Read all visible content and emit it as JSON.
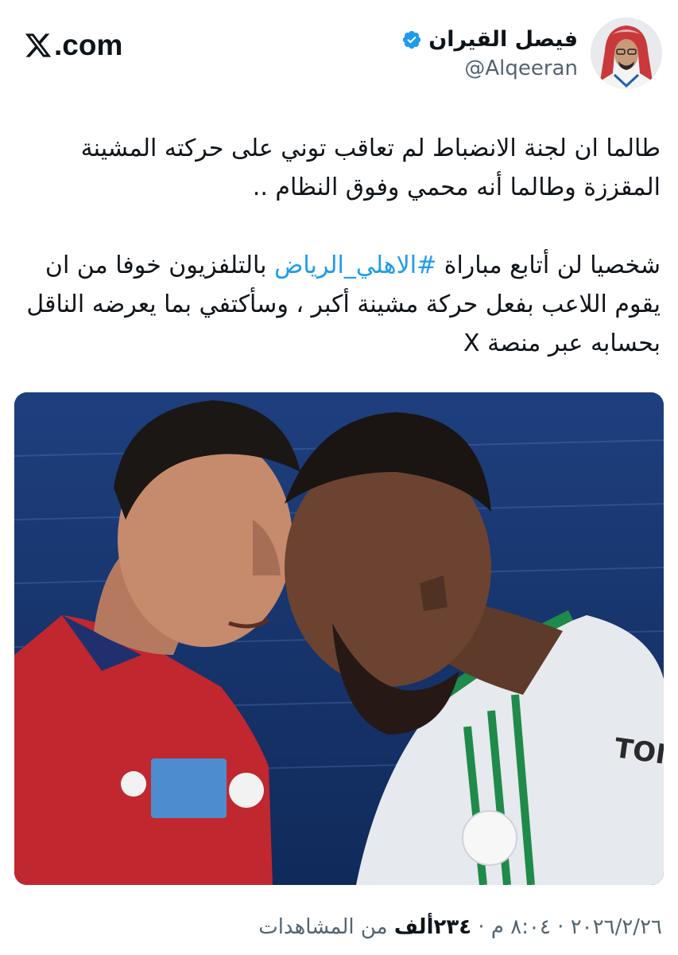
{
  "brand": {
    "label": ".com",
    "icon": "x-logo-icon"
  },
  "author": {
    "display_name": "فيصل القيران",
    "handle": "@Alqeeran",
    "verified": true,
    "verified_color": "#1d9bf0"
  },
  "tweet": {
    "paragraph_1": "طالما ان لجنة الانضباط لم تعاقب توني على حركته المشينة المقززة وطالما أنه محمي وفوق النظام ..",
    "paragraph_2_before": "شخصيا لن أتابع مباراة ",
    "hashtag": "#الاهلي_الرياض",
    "paragraph_2_after": " بالتلفزيون خوفا من ان يقوم اللاعب بفعل حركة مشينة أكبر ، وسأكتفي بما يعرضه الناقل بحسابه عبر منصة X",
    "hashtag_color": "#1d9bf0"
  },
  "media": {
    "type": "photo",
    "jersey_lettering": "TON"
  },
  "meta": {
    "date": "٢٠٢٦/٢/٢٦",
    "separator": " · ",
    "time": "٨:٠٤ م",
    "views_count": "٢٣٤ألف",
    "views_label": " من المشاهدات"
  }
}
